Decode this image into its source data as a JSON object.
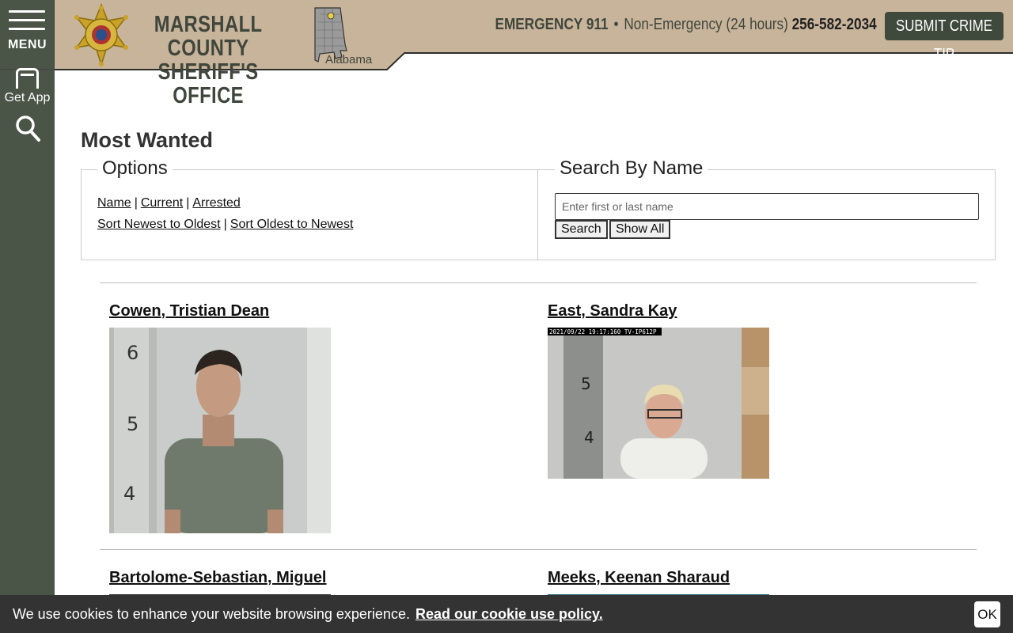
{
  "nav": {
    "menu_label": "MENU",
    "app_label": "Get App"
  },
  "header": {
    "org_line1": "MARSHALL COUNTY",
    "org_line2": "SHERIFF'S OFFICE",
    "state_label": "Alabama",
    "emergency_label": "EMERGENCY 911",
    "separator": "•",
    "nonemergency_label": "Non-Emergency (24 hours)",
    "nonemergency_phone": "256-582-2034",
    "tip_button": "SUBMIT CRIME TIP",
    "colors": {
      "header_bg": "#c8b49a",
      "rail_bg": "#4a5447",
      "brand_text": "#3f463c",
      "badge_gold": "#c9a227"
    }
  },
  "page": {
    "title": "Most Wanted"
  },
  "options": {
    "legend": "Options",
    "filter_name": "Name",
    "filter_current": "Current",
    "filter_arrested": "Arrested",
    "sep": "|",
    "sort_newest": "Sort Newest to Oldest",
    "sort_oldest": "Sort Oldest to Newest"
  },
  "search": {
    "legend": "Search By Name",
    "placeholder": "Enter first or last name",
    "value": "",
    "search_button": "Search",
    "show_all_button": "Show All"
  },
  "people": [
    {
      "name": "Cowen, Tristian Dean",
      "photo_caption": ""
    },
    {
      "name": "East, Sandra Kay",
      "photo_caption": "2021/09/22 19:17:160 TV-IP612P"
    },
    {
      "name": "Bartolome-Sebastian, Miguel",
      "photo_caption": ""
    },
    {
      "name": "Meeks, Keenan Sharaud",
      "photo_caption": ""
    }
  ],
  "photo_scale_marks": {
    "p1": [
      "6",
      "5",
      "4"
    ],
    "p2": [
      "5",
      "4"
    ]
  },
  "cookie": {
    "text": "We use cookies to enhance your website browsing experience.",
    "link": "Read our cookie use policy.",
    "ok": "OK"
  }
}
